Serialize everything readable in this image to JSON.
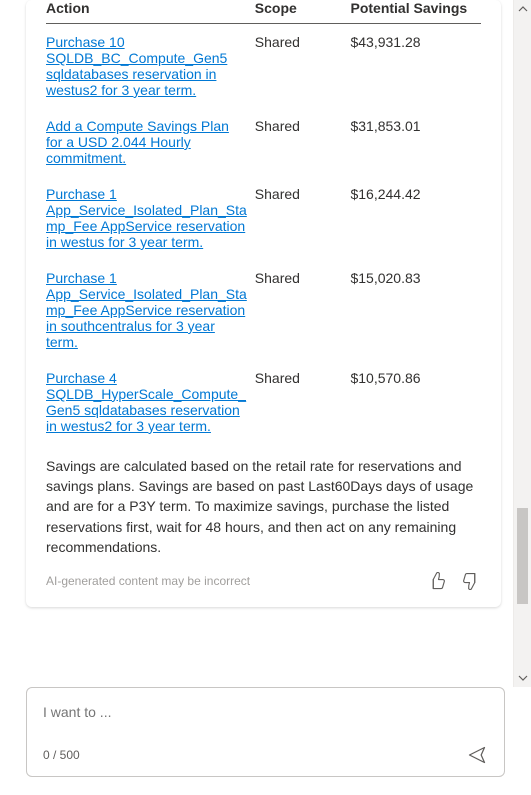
{
  "table": {
    "headers": {
      "action": "Action",
      "scope": "Scope",
      "savings": "Potential Savings"
    },
    "rows": [
      {
        "action": "Purchase 10 SQLDB_BC_Compute_Gen5 sqldatabases reservation in westus2 for 3 year term.",
        "scope": "Shared",
        "savings": "$43,931.28"
      },
      {
        "action": "Add a Compute Savings Plan for a USD 2.044 Hourly commitment.",
        "scope": "Shared",
        "savings": "$31,853.01"
      },
      {
        "action": "Purchase 1 App_Service_Isolated_Plan_Stamp_Fee AppService reservation in westus for 3 year term.",
        "scope": "Shared",
        "savings": "$16,244.42"
      },
      {
        "action": "Purchase 1 App_Service_Isolated_Plan_Stamp_Fee AppService reservation in southcentralus for 3 year term.",
        "scope": "Shared",
        "savings": "$15,020.83"
      },
      {
        "action": "Purchase 4 SQLDB_HyperScale_Compute_Gen5 sqldatabases reservation in westus2 for 3 year term.",
        "scope": "Shared",
        "savings": "$10,570.86"
      }
    ]
  },
  "footnote": "Savings are calculated based on the retail rate for reservations and savings plans. Savings are based on past Last60Days days of usage and are for a P3Y term. To maximize savings, purchase the listed reservations first, wait for 48 hours, and then act on any remaining recommendations.",
  "ai_disclaimer": "AI-generated content may be incorrect",
  "input": {
    "placeholder": "I want to ...",
    "char_count": "0 / 500"
  }
}
